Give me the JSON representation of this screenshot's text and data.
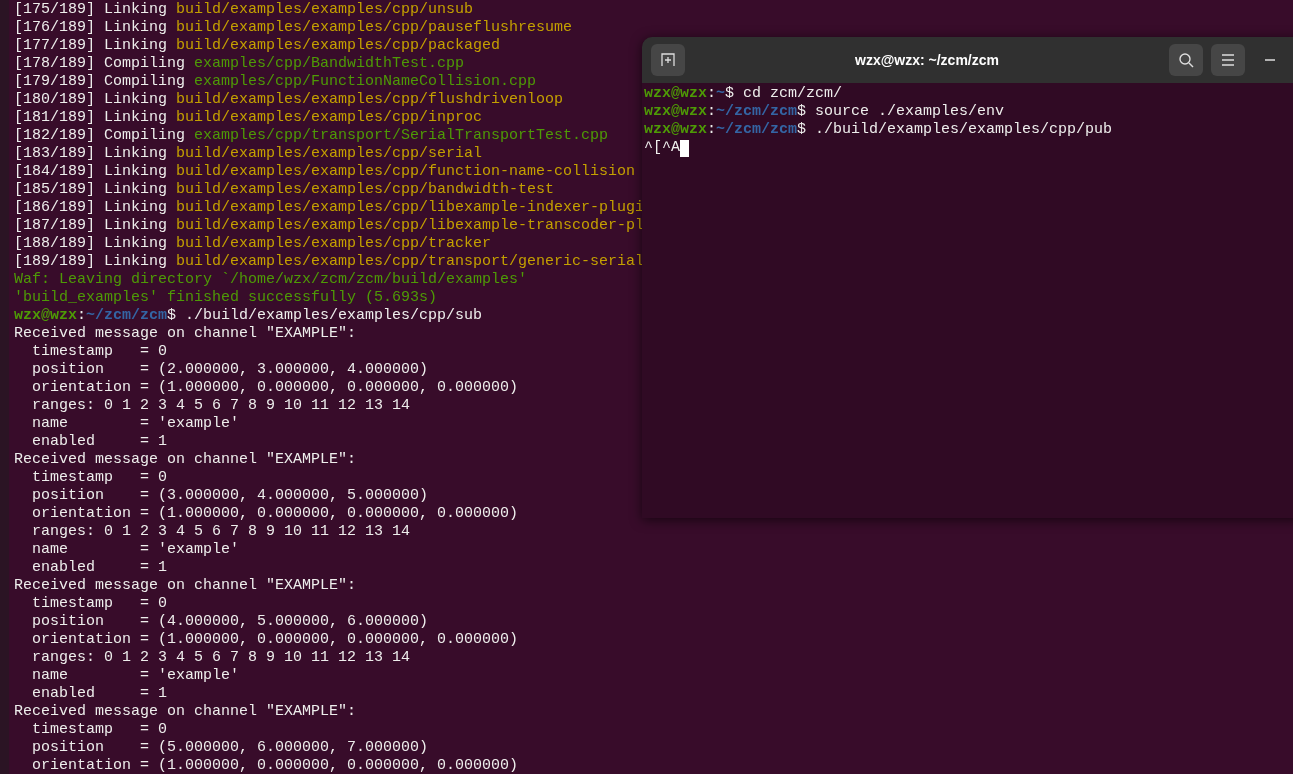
{
  "background_terminal": {
    "lines": [
      [
        {
          "kind": "plain",
          "text": "[175/189] Linking "
        },
        {
          "kind": "target",
          "text": "build/examples/examples/cpp/unsub"
        }
      ],
      [
        {
          "kind": "plain",
          "text": "[176/189] Linking "
        },
        {
          "kind": "target",
          "text": "build/examples/examples/cpp/pauseflushresume"
        }
      ],
      [
        {
          "kind": "plain",
          "text": "[177/189] Linking "
        },
        {
          "kind": "target",
          "text": "build/examples/examples/cpp/packaged"
        }
      ],
      [
        {
          "kind": "plain",
          "text": "[178/189] Compiling "
        },
        {
          "kind": "source",
          "text": "examples/cpp/BandwidthTest.cpp"
        }
      ],
      [
        {
          "kind": "plain",
          "text": "[179/189] Compiling "
        },
        {
          "kind": "source",
          "text": "examples/cpp/FunctionNameCollision.cpp"
        }
      ],
      [
        {
          "kind": "plain",
          "text": "[180/189] Linking "
        },
        {
          "kind": "target",
          "text": "build/examples/examples/cpp/flushdrivenloop"
        }
      ],
      [
        {
          "kind": "plain",
          "text": "[181/189] Linking "
        },
        {
          "kind": "target",
          "text": "build/examples/examples/cpp/inproc"
        }
      ],
      [
        {
          "kind": "plain",
          "text": "[182/189] Compiling "
        },
        {
          "kind": "source",
          "text": "examples/cpp/transport/SerialTransportTest.cpp"
        }
      ],
      [
        {
          "kind": "plain",
          "text": "[183/189] Linking "
        },
        {
          "kind": "target",
          "text": "build/examples/examples/cpp/serial"
        }
      ],
      [
        {
          "kind": "plain",
          "text": "[184/189] Linking "
        },
        {
          "kind": "target",
          "text": "build/examples/examples/cpp/function-name-collision"
        }
      ],
      [
        {
          "kind": "plain",
          "text": "[185/189] Linking "
        },
        {
          "kind": "target",
          "text": "build/examples/examples/cpp/bandwidth-test"
        }
      ],
      [
        {
          "kind": "plain",
          "text": "[186/189] Linking "
        },
        {
          "kind": "target",
          "text": "build/examples/examples/cpp/libexample-indexer-plugi"
        }
      ],
      [
        {
          "kind": "plain",
          "text": "[187/189] Linking "
        },
        {
          "kind": "target",
          "text": "build/examples/examples/cpp/libexample-transcoder-pl"
        }
      ],
      [
        {
          "kind": "plain",
          "text": "[188/189] Linking "
        },
        {
          "kind": "target",
          "text": "build/examples/examples/cpp/tracker"
        }
      ],
      [
        {
          "kind": "plain",
          "text": "[189/189] Linking "
        },
        {
          "kind": "target",
          "text": "build/examples/examples/cpp/transport/generic-serial"
        }
      ],
      [
        {
          "kind": "source",
          "text": "Waf: Leaving directory `/home/wzx/zcm/zcm/build/examples'"
        }
      ],
      [
        {
          "kind": "source",
          "text": "'build_examples' finished successfully (5.693s)"
        }
      ],
      [
        {
          "kind": "user",
          "text": "wzx@wzx"
        },
        {
          "kind": "plain",
          "text": ":"
        },
        {
          "kind": "path",
          "text": "~/zcm/zcm"
        },
        {
          "kind": "plain",
          "text": "$ ./build/examples/examples/cpp/sub"
        }
      ],
      [
        {
          "kind": "plain",
          "text": "Received message on channel \"EXAMPLE\":"
        }
      ],
      [
        {
          "kind": "plain",
          "text": "  timestamp   = 0"
        }
      ],
      [
        {
          "kind": "plain",
          "text": "  position    = (2.000000, 3.000000, 4.000000)"
        }
      ],
      [
        {
          "kind": "plain",
          "text": "  orientation = (1.000000, 0.000000, 0.000000, 0.000000)"
        }
      ],
      [
        {
          "kind": "plain",
          "text": "  ranges: 0 1 2 3 4 5 6 7 8 9 10 11 12 13 14"
        }
      ],
      [
        {
          "kind": "plain",
          "text": "  name        = 'example'"
        }
      ],
      [
        {
          "kind": "plain",
          "text": "  enabled     = 1"
        }
      ],
      [
        {
          "kind": "plain",
          "text": "Received message on channel \"EXAMPLE\":"
        }
      ],
      [
        {
          "kind": "plain",
          "text": "  timestamp   = 0"
        }
      ],
      [
        {
          "kind": "plain",
          "text": "  position    = (3.000000, 4.000000, 5.000000)"
        }
      ],
      [
        {
          "kind": "plain",
          "text": "  orientation = (1.000000, 0.000000, 0.000000, 0.000000)"
        }
      ],
      [
        {
          "kind": "plain",
          "text": "  ranges: 0 1 2 3 4 5 6 7 8 9 10 11 12 13 14"
        }
      ],
      [
        {
          "kind": "plain",
          "text": "  name        = 'example'"
        }
      ],
      [
        {
          "kind": "plain",
          "text": "  enabled     = 1"
        }
      ],
      [
        {
          "kind": "plain",
          "text": "Received message on channel \"EXAMPLE\":"
        }
      ],
      [
        {
          "kind": "plain",
          "text": "  timestamp   = 0"
        }
      ],
      [
        {
          "kind": "plain",
          "text": "  position    = (4.000000, 5.000000, 6.000000)"
        }
      ],
      [
        {
          "kind": "plain",
          "text": "  orientation = (1.000000, 0.000000, 0.000000, 0.000000)"
        }
      ],
      [
        {
          "kind": "plain",
          "text": "  ranges: 0 1 2 3 4 5 6 7 8 9 10 11 12 13 14"
        }
      ],
      [
        {
          "kind": "plain",
          "text": "  name        = 'example'"
        }
      ],
      [
        {
          "kind": "plain",
          "text": "  enabled     = 1"
        }
      ],
      [
        {
          "kind": "plain",
          "text": "Received message on channel \"EXAMPLE\":"
        }
      ],
      [
        {
          "kind": "plain",
          "text": "  timestamp   = 0"
        }
      ],
      [
        {
          "kind": "plain",
          "text": "  position    = (5.000000, 6.000000, 7.000000)"
        }
      ],
      [
        {
          "kind": "plain",
          "text": "  orientation = (1.000000, 0.000000, 0.000000, 0.000000)"
        }
      ]
    ]
  },
  "window": {
    "title": "wzx@wzx: ~/zcm/zcm",
    "lines": [
      [
        {
          "kind": "user",
          "text": "wzx@wzx"
        },
        {
          "kind": "plain",
          "text": ":"
        },
        {
          "kind": "path",
          "text": "~"
        },
        {
          "kind": "plain",
          "text": "$ cd zcm/zcm/"
        }
      ],
      [
        {
          "kind": "user",
          "text": "wzx@wzx"
        },
        {
          "kind": "plain",
          "text": ":"
        },
        {
          "kind": "path",
          "text": "~/zcm/zcm"
        },
        {
          "kind": "plain",
          "text": "$ source ./examples/env"
        }
      ],
      [
        {
          "kind": "user",
          "text": "wzx@wzx"
        },
        {
          "kind": "plain",
          "text": ":"
        },
        {
          "kind": "path",
          "text": "~/zcm/zcm"
        },
        {
          "kind": "plain",
          "text": "$ ./build/examples/examples/cpp/pub"
        }
      ],
      [
        {
          "kind": "plain",
          "text": "^[^A"
        },
        {
          "kind": "cursor"
        }
      ]
    ]
  }
}
